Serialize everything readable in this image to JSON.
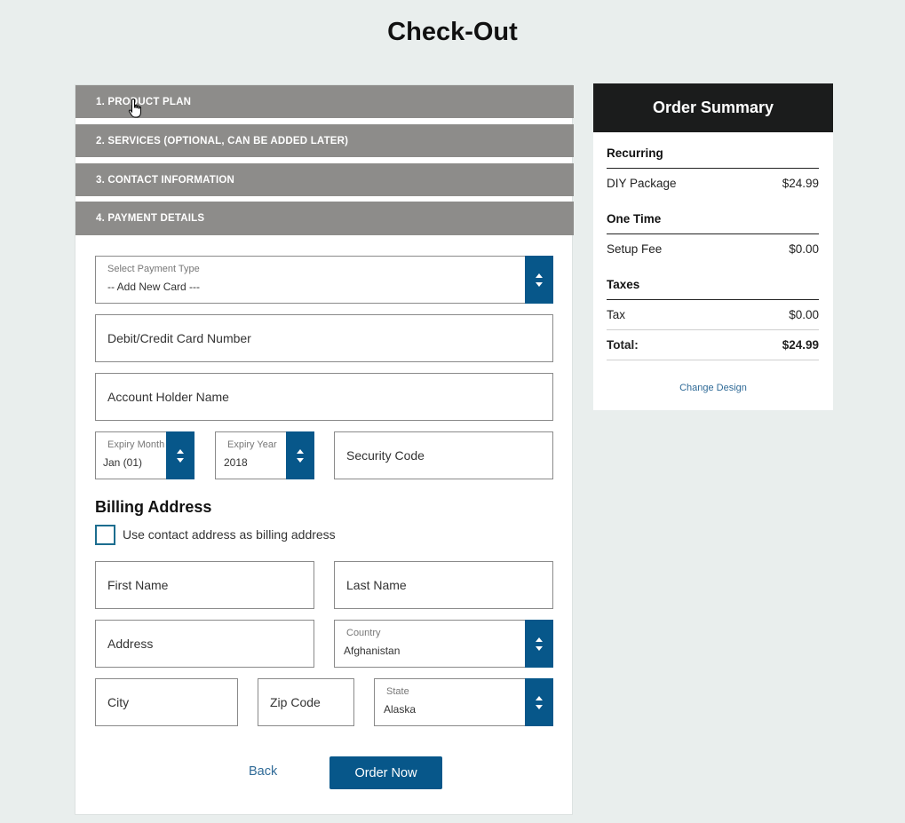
{
  "page": {
    "title": "Check-Out"
  },
  "steps": [
    {
      "label": "1. PRODUCT PLAN"
    },
    {
      "label": "2. SERVICES (OPTIONAL, CAN BE ADDED LATER)"
    },
    {
      "label": "3. CONTACT INFORMATION"
    },
    {
      "label": "4. PAYMENT DETAILS"
    }
  ],
  "payment": {
    "payment_type": {
      "label": "Select Payment Type",
      "value": "-- Add New Card ---"
    },
    "card_number": {
      "placeholder": "Debit/Credit Card Number"
    },
    "holder_name": {
      "placeholder": "Account Holder Name"
    },
    "expiry_month": {
      "label": "Expiry Month",
      "value": "Jan (01)"
    },
    "expiry_year": {
      "label": "Expiry Year",
      "value": "2018"
    },
    "security_code": {
      "placeholder": "Security Code"
    }
  },
  "billing": {
    "heading": "Billing Address",
    "use_contact_label": "Use contact address as billing address",
    "first_name": {
      "placeholder": "First Name"
    },
    "last_name": {
      "placeholder": "Last Name"
    },
    "address": {
      "placeholder": "Address"
    },
    "country": {
      "label": "Country",
      "value": "Afghanistan"
    },
    "city": {
      "placeholder": "City"
    },
    "zip": {
      "placeholder": "Zip Code"
    },
    "state": {
      "label": "State",
      "value": "Alaska"
    }
  },
  "actions": {
    "back_label": "Back",
    "order_label": "Order Now"
  },
  "summary": {
    "title": "Order Summary",
    "recurring_heading": "Recurring",
    "recurring_item": {
      "name": "DIY Package",
      "price": "$24.99"
    },
    "onetime_heading": "One Time",
    "onetime_item": {
      "name": "Setup Fee",
      "price": "$0.00"
    },
    "taxes_heading": "Taxes",
    "tax_item": {
      "name": "Tax",
      "price": "$0.00"
    },
    "total": {
      "label": "Total:",
      "price": "$24.99"
    },
    "change_design_label": "Change Design"
  },
  "colors": {
    "accent": "#07578a",
    "step_bar": "#8d8c8a",
    "summary_header": "#1b1c1c",
    "link": "#2f6a97"
  }
}
